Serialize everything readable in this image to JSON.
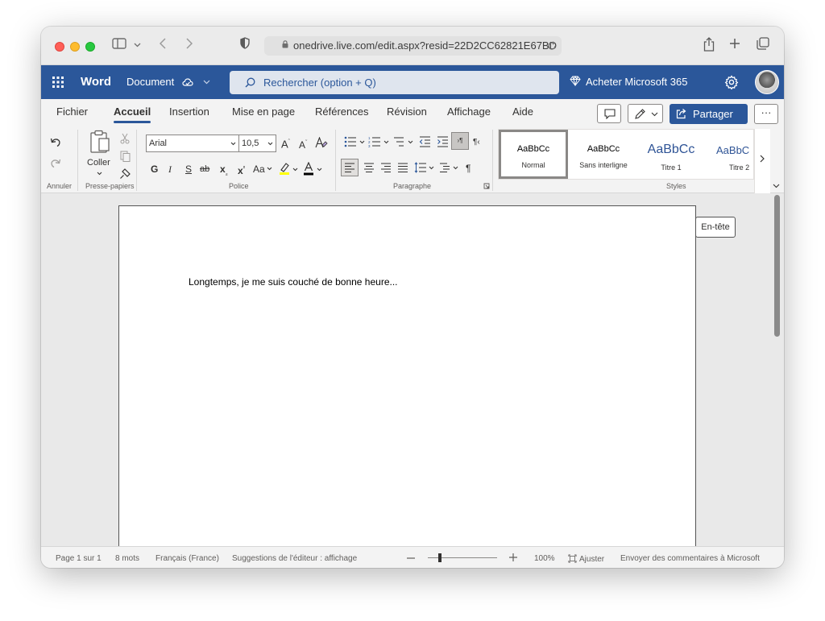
{
  "browser": {
    "url": "onedrive.live.com/edit.aspx?resid=22D2CC62821E67BD"
  },
  "header": {
    "app_name": "Word",
    "doc_name": "Document",
    "search_placeholder": "Rechercher (option + Q)",
    "buy_label": "Acheter Microsoft 365",
    "accent": "#2b579a"
  },
  "tabs": [
    {
      "label": "Fichier"
    },
    {
      "label": "Accueil"
    },
    {
      "label": "Insertion"
    },
    {
      "label": "Mise en page"
    },
    {
      "label": "Références"
    },
    {
      "label": "Révision"
    },
    {
      "label": "Affichage"
    },
    {
      "label": "Aide"
    }
  ],
  "share_label": "Partager",
  "more_label": "···",
  "ribbon": {
    "undo_group": "Annuler",
    "clipboard": {
      "paste_label": "Coller",
      "group": "Presse-papiers"
    },
    "font": {
      "name": "Arial",
      "size": "10,5",
      "group": "Police",
      "case_label": "Aa"
    },
    "paragraph": {
      "group": "Paragraphe"
    },
    "styles": {
      "group": "Styles",
      "tiles": [
        {
          "preview": "AaBbCc",
          "name": "Normal",
          "selected": true
        },
        {
          "preview": "AaBbCc",
          "name": "Sans interligne"
        },
        {
          "preview": "AaBbCc",
          "name": "Titre 1"
        },
        {
          "preview": "AaBbC",
          "name": "Titre 2"
        }
      ]
    }
  },
  "document": {
    "text": "Longtemps, je me suis couché de bonne heure...",
    "header_tag": "En-tête"
  },
  "statusbar": {
    "page": "Page 1 sur 1",
    "words": "8 mots",
    "language": "Français (France)",
    "suggestions": "Suggestions de l'éditeur : affichage",
    "zoom": "100%",
    "fit": "Ajuster",
    "feedback": "Envoyer des commentaires à Microsoft",
    "zoom_level": 100
  }
}
